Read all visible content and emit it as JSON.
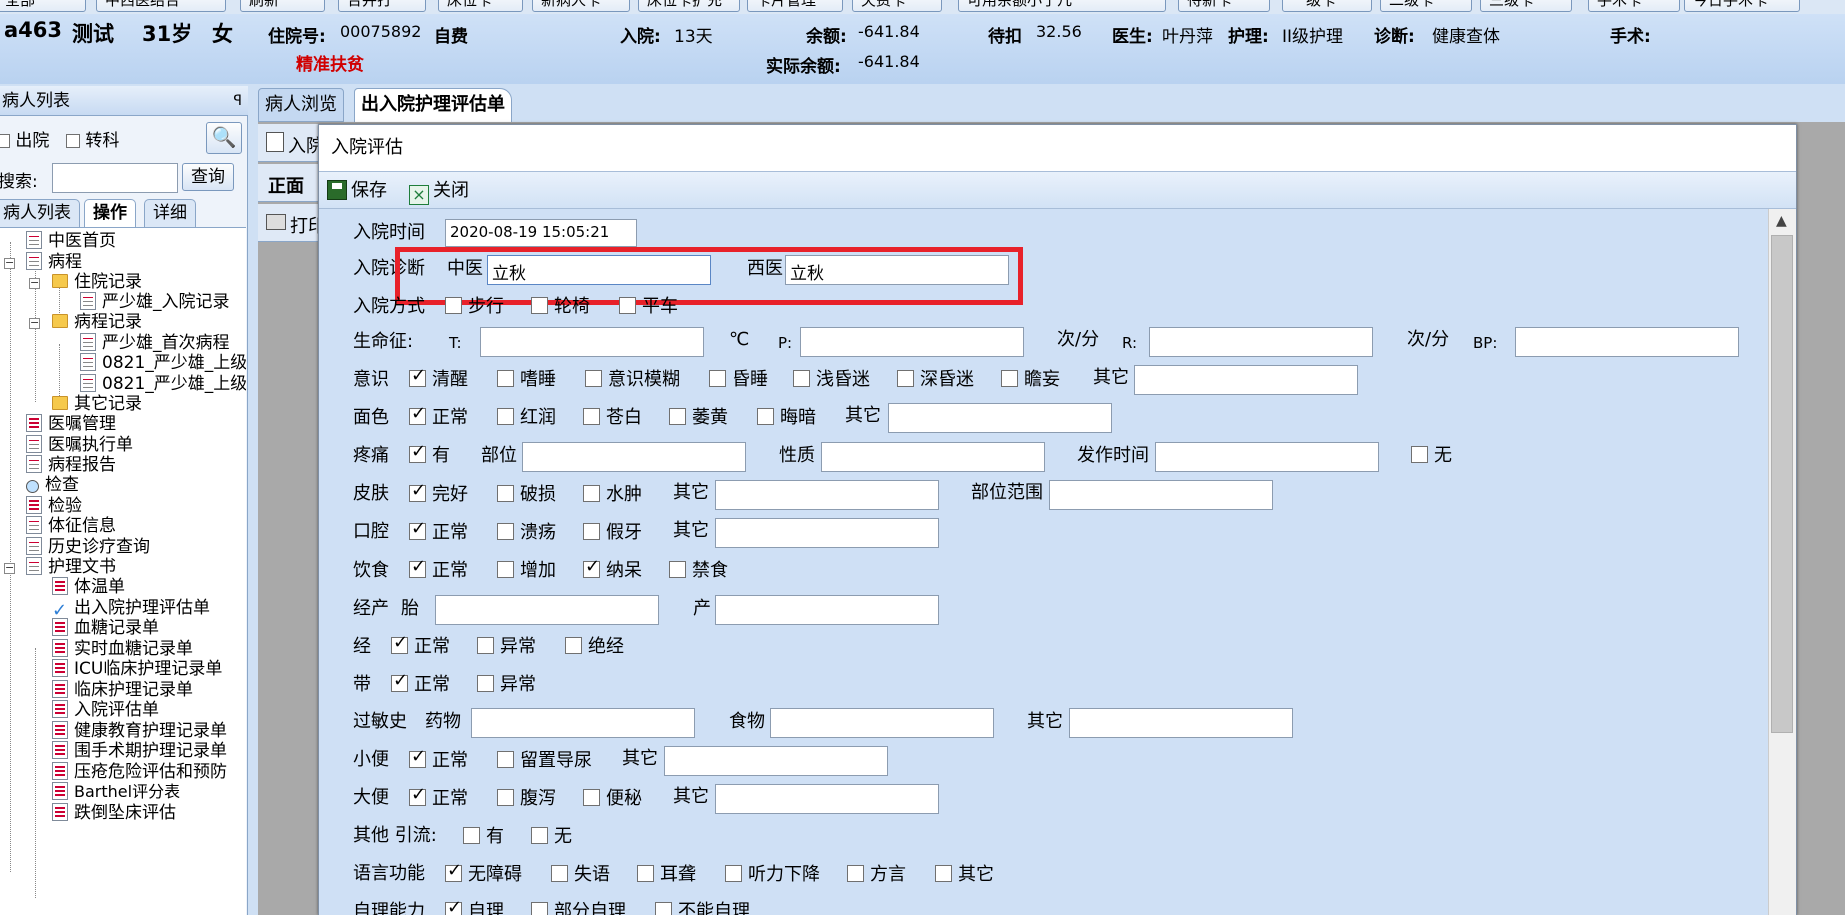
{
  "top_buttons": [
    "全部",
    "中西医结合",
    "刷新",
    "合并打",
    "床位卡",
    "新病人卡",
    "床位卡扩充",
    "卡片管理",
    "欠费卡",
    "可用余额小于几",
    "待新卡",
    "一级卡",
    "二级卡",
    "三级卡",
    "手术卡",
    "今日手术卡"
  ],
  "patient": {
    "bed": "a463",
    "name": "测试",
    "age": "31岁",
    "sex": "女",
    "inpatient_no_label": "住院号:",
    "inpatient_no": "00075892",
    "pay_type": "自费",
    "poverty_tag": "精准扶贫",
    "admit_label": "入院:",
    "admit_days": "13天",
    "balance_label": "余额:",
    "balance": "-641.84",
    "actual_balance_label": "实际余额:",
    "actual_balance": "-641.84",
    "pending_label": "待扣",
    "pending": "32.56",
    "doctor_label": "医生:",
    "doctor": "叶丹萍",
    "nursing_label": "护理:",
    "nursing": "II级护理",
    "diagnosis_label": "诊断:",
    "diagnosis": "健康查体",
    "surgery_label": "手术:"
  },
  "left_panel": {
    "title": "病人列表",
    "pin": "ꟼ",
    "discharged": "出院",
    "transfer": "转科",
    "search_label": "搜索:",
    "query_button": "查询",
    "tabs": [
      "病人列表",
      "操作",
      "详细"
    ],
    "tree": [
      "中医首页",
      "病程",
      "住院记录",
      "严少雄_入院记录",
      "病程记录",
      "严少雄_首次病程",
      "0821_严少雄_上级",
      "0821_严少雄_上级",
      "其它记录",
      "医嘱管理",
      "医嘱执行单",
      "病程报告",
      "检查",
      "检验",
      "体征信息",
      "历史诊疗查询",
      "护理文书",
      "体温单",
      "出入院护理评估单",
      "血糖记录单",
      "实时血糖记录单",
      "ICU临床护理记录单",
      "临床护理记录单",
      "入院评估单",
      "健康教育护理记录单",
      "围手术期护理记录单",
      "压疮危险评估和预防",
      "Barthel评分表",
      "跌倒坠床评估"
    ]
  },
  "main_tabs": [
    "病人浏览",
    "出入院护理评估单"
  ],
  "background": {
    "tab_label": "入院",
    "front_label": "正面",
    "print_label": "打印"
  },
  "dialog": {
    "title": "入院评估",
    "save": "保存",
    "close": "关闭",
    "admit_time_label": "入院时间",
    "admit_time": "2020-08-19 15:05:21",
    "diag_label": "入院诊断",
    "tcm_label": "中医",
    "tcm_value": "立秋",
    "wm_label": "西医",
    "wm_value": "立秋",
    "mode_label": "入院方式",
    "mode_opts": [
      "步行",
      "轮椅",
      "平车"
    ],
    "vital_label": "生命征:",
    "t_label": "T:",
    "t_unit": "℃",
    "p_label": "P:",
    "p_unit": "次/分",
    "r_label": "R:",
    "r_unit": "次/分",
    "bp_label": "BP:",
    "conscious_label": "意识",
    "conscious_opts": [
      "清醒",
      "嗜睡",
      "意识模糊",
      "昏睡",
      "浅昏迷",
      "深昏迷",
      "瞻妄"
    ],
    "other": "其它",
    "face_label": "面色",
    "face_opts": [
      "正常",
      "红润",
      "苍白",
      "萎黄",
      "晦暗"
    ],
    "pain_label": "疼痛",
    "pain_yes": "有",
    "pain_site": "部位",
    "pain_nature": "性质",
    "pain_onset": "发作时间",
    "pain_no": "无",
    "skin_label": "皮肤",
    "skin_opts": [
      "完好",
      "破损",
      "水肿"
    ],
    "skin_range": "部位范围",
    "mouth_label": "口腔",
    "mouth_opts": [
      "正常",
      "溃疡",
      "假牙"
    ],
    "diet_label": "饮食",
    "diet_opts": [
      "正常",
      "增加",
      "纳呆",
      "禁食"
    ],
    "obst_label": "经产",
    "obst_g": "胎",
    "obst_p": "产",
    "menses_label": "经",
    "menses_opts": [
      "正常",
      "异常",
      "绝经"
    ],
    "leuk_label": "带",
    "leuk_opts": [
      "正常",
      "异常"
    ],
    "allergy_label": "过敏史",
    "allergy_drug": "药物",
    "allergy_food": "食物",
    "urine_label": "小便",
    "urine_opts": [
      "正常",
      "留置导尿"
    ],
    "stool_label": "大便",
    "stool_opts": [
      "正常",
      "腹泻",
      "便秘"
    ],
    "drain_label": "其他 引流:",
    "drain_opts": [
      "有",
      "无"
    ],
    "lang_label": "语言功能",
    "lang_opts": [
      "无障碍",
      "失语",
      "耳聋",
      "听力下降",
      "方言",
      "其它"
    ],
    "selfcare_label": "自理能力",
    "selfcare_opts": [
      "自理",
      "部分自理",
      "不能自理"
    ]
  },
  "colors": {
    "highlight": "#e8212a",
    "form_bg": "#cfe0f5",
    "header_bg": "#bcd4f1",
    "red_text": "#d10000"
  }
}
